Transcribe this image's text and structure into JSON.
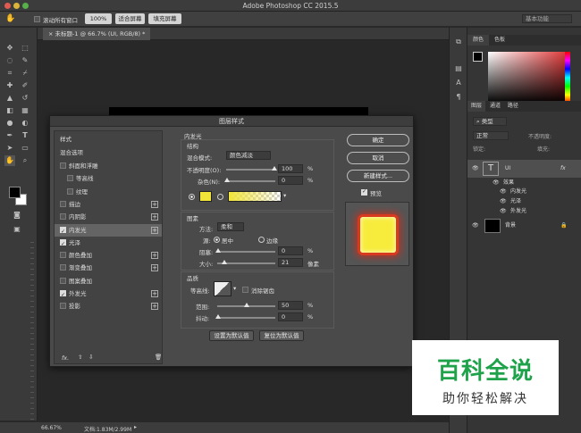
{
  "app": {
    "title": "Adobe Photoshop CC 2015.5"
  },
  "options_bar": {
    "scroll_all_windows": "滚动所有窗口",
    "zoom_100": "100%",
    "fit_screen": "适合屏幕",
    "fill_screen": "填充屏幕",
    "workspace": "基本功能"
  },
  "document": {
    "tab_label": "未标题-1 @ 66.7% (UI, RGB/8) *"
  },
  "status": {
    "zoom": "66.67%",
    "doc_info": "文档:1.83M/2.99M"
  },
  "color_panel": {
    "tab_color": "颜色",
    "tab_swatches": "色板"
  },
  "layers_panel": {
    "tab_layers": "图层",
    "tab_channels": "通道",
    "tab_paths": "路径",
    "kind_label": "类型",
    "mode_label": "正常",
    "opacity_label": "不透明度:",
    "fill_label": "填充:",
    "lock_label": "锁定:",
    "layers": [
      {
        "name": "UI",
        "fx": "fx"
      },
      {
        "name": "背景"
      }
    ],
    "effects_label": "效果",
    "effects": [
      "内发光",
      "光泽",
      "外发光"
    ]
  },
  "dialog": {
    "title": "图层样式",
    "styles_header": "样式",
    "blend_options": "混合选项",
    "items": [
      {
        "label": "斜面和浮雕",
        "checked": false
      },
      {
        "label": "等高线",
        "checked": false
      },
      {
        "label": "纹理",
        "checked": false
      },
      {
        "label": "描边",
        "checked": false
      },
      {
        "label": "内阴影",
        "checked": false
      },
      {
        "label": "内发光",
        "checked": true
      },
      {
        "label": "光泽",
        "checked": true
      },
      {
        "label": "颜色叠加",
        "checked": false
      },
      {
        "label": "渐变叠加",
        "checked": false
      },
      {
        "label": "图案叠加",
        "checked": false
      },
      {
        "label": "外发光",
        "checked": true
      },
      {
        "label": "投影",
        "checked": false
      }
    ],
    "fx_label": "fx.",
    "inner_glow": {
      "title": "内发光",
      "structure": "结构",
      "blend_mode_label": "混合模式:",
      "blend_mode": "颜色减淡",
      "opacity_label": "不透明度(O):",
      "opacity": "100",
      "noise_label": "杂色(N):",
      "noise": "0",
      "percent": "%",
      "elements": "图素",
      "method_label": "方法:",
      "method": "柔和",
      "source_label": "源:",
      "source_center": "居中",
      "source_edge": "边缘",
      "choke_label": "阻塞:",
      "choke": "0",
      "size_label": "大小:",
      "size": "21",
      "pixels": "像素",
      "quality": "品质",
      "contour_label": "等高线:",
      "anti_alias": "消除锯齿",
      "range_label": "范围:",
      "range": "50",
      "jitter_label": "抖动:",
      "jitter": "0",
      "set_default": "设置为默认值",
      "reset_default": "复位为默认值",
      "glow_color": "#f2e53a"
    },
    "ok": "确定",
    "cancel": "取消",
    "new_style": "新建样式...",
    "preview": "预览"
  },
  "watermark": {
    "line1": "百科全说",
    "line2": "助你轻松解决"
  }
}
